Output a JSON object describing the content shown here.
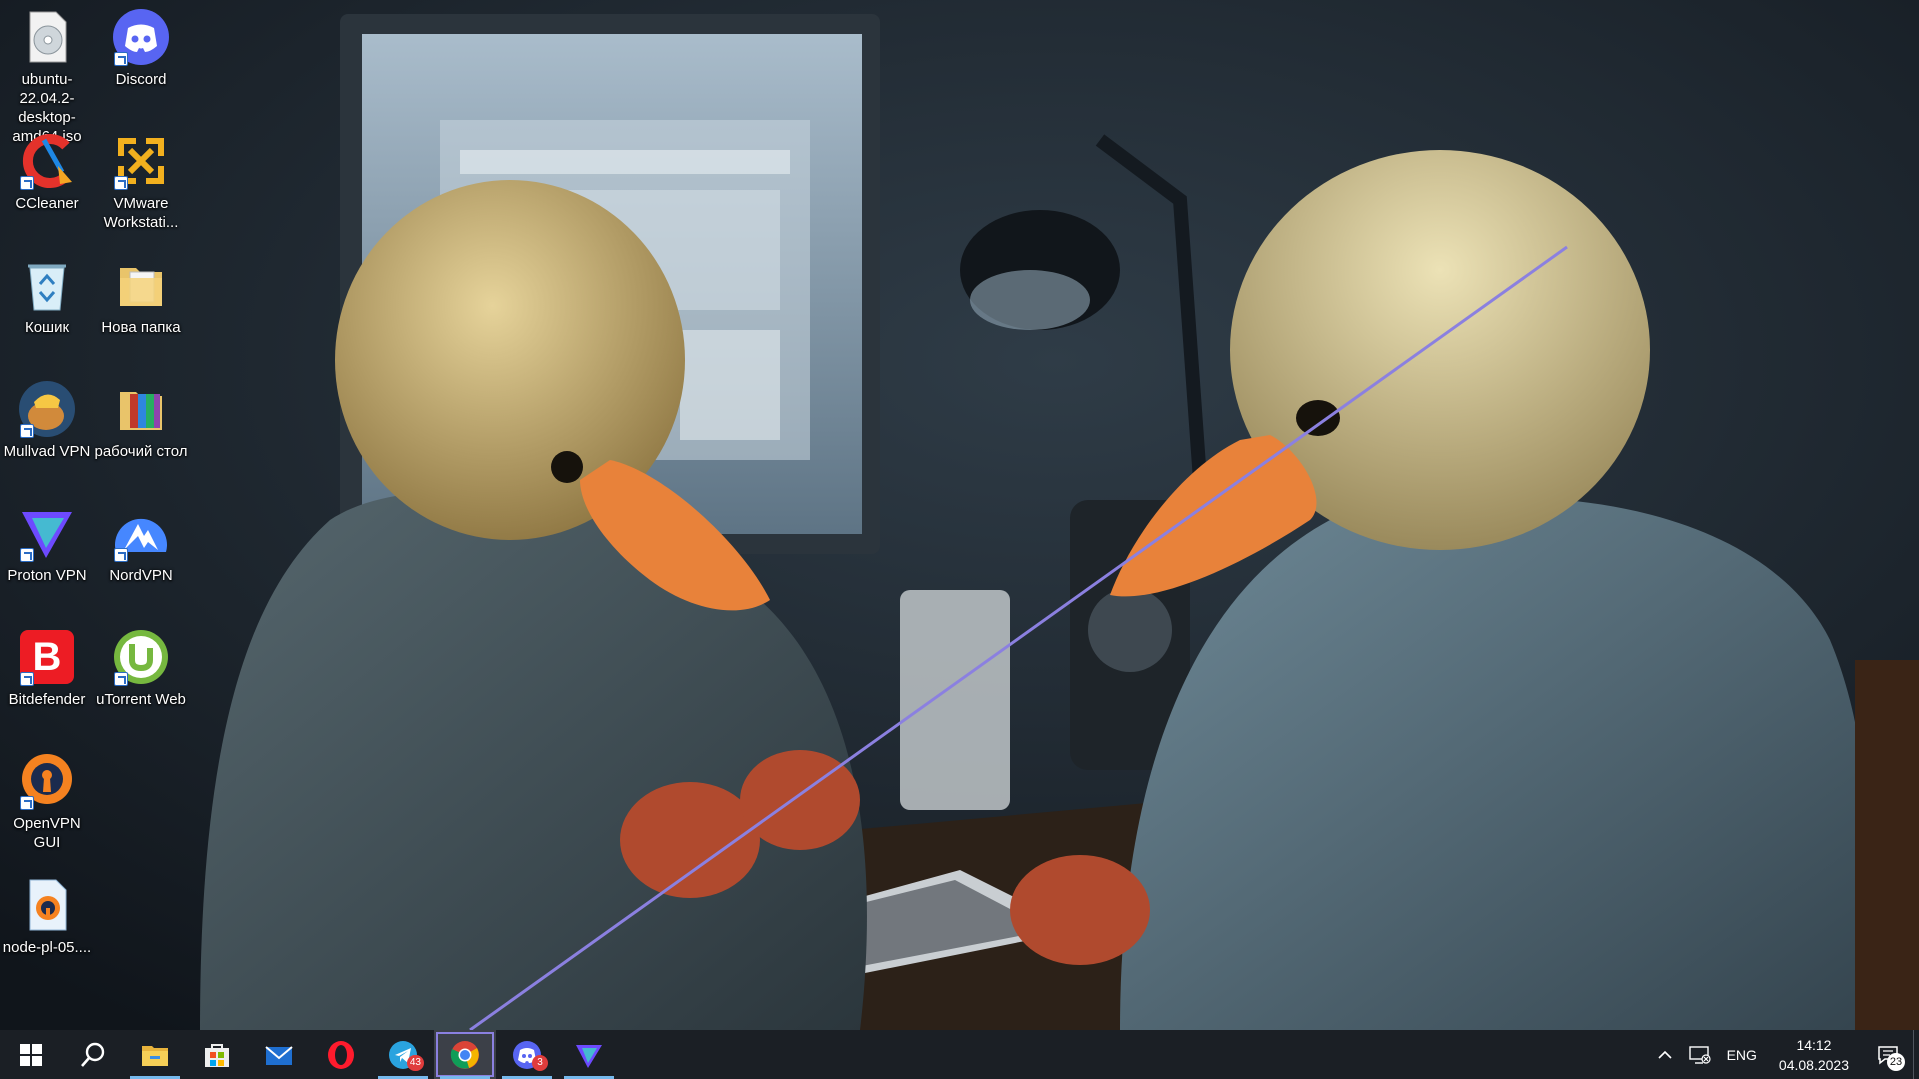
{
  "desktop": {
    "icons": [
      {
        "id": "ubuntu-iso",
        "label": "ubuntu-22.04.2-desktop-amd64.iso",
        "icon": "disc-image-icon"
      },
      {
        "id": "discord",
        "label": "Discord",
        "icon": "discord-icon"
      },
      {
        "id": "ccleaner",
        "label": "CCleaner",
        "icon": "ccleaner-icon"
      },
      {
        "id": "vmware",
        "label": "VMware Workstati...",
        "icon": "vmware-icon"
      },
      {
        "id": "recycle-bin",
        "label": "Кошик",
        "icon": "recycle-bin-icon"
      },
      {
        "id": "new-folder",
        "label": "Нова папка",
        "icon": "folder-icon"
      },
      {
        "id": "mullvad",
        "label": "Mullvad VPN",
        "icon": "mullvad-icon"
      },
      {
        "id": "desktop-folder",
        "label": "рабочий стол",
        "icon": "archive-folder-icon"
      },
      {
        "id": "protonvpn",
        "label": "Proton VPN",
        "icon": "protonvpn-icon"
      },
      {
        "id": "nordvpn",
        "label": "NordVPN",
        "icon": "nordvpn-icon"
      },
      {
        "id": "bitdefender",
        "label": "Bitdefender",
        "icon": "bitdefender-icon"
      },
      {
        "id": "utorrent",
        "label": "uTorrent Web",
        "icon": "utorrent-icon"
      },
      {
        "id": "openvpn",
        "label": "OpenVPN GUI",
        "icon": "openvpn-icon"
      },
      {
        "id": "node-file",
        "label": "node-pl-05....",
        "icon": "ovpn-file-icon"
      }
    ]
  },
  "taskbar": {
    "buttons": [
      {
        "id": "start",
        "icon": "windows-start-icon"
      },
      {
        "id": "search",
        "icon": "search-icon"
      },
      {
        "id": "explorer",
        "icon": "file-explorer-icon"
      },
      {
        "id": "store",
        "icon": "microsoft-store-icon"
      },
      {
        "id": "mail",
        "icon": "mail-icon"
      },
      {
        "id": "opera",
        "icon": "opera-icon"
      },
      {
        "id": "telegram",
        "icon": "telegram-icon",
        "badge": "43"
      },
      {
        "id": "chrome",
        "icon": "chrome-icon"
      },
      {
        "id": "discord",
        "icon": "discord-icon",
        "badge": "3"
      },
      {
        "id": "protonvpn",
        "icon": "protonvpn-icon"
      }
    ],
    "tray": {
      "language": "ENG",
      "time": "14:12",
      "date": "04.08.2023",
      "notification_count": "23"
    }
  },
  "colors": {
    "taskbar_bg": "#1b1f25",
    "running_indicator": "#76b9ed",
    "annotation_line": "#8b80e0"
  }
}
